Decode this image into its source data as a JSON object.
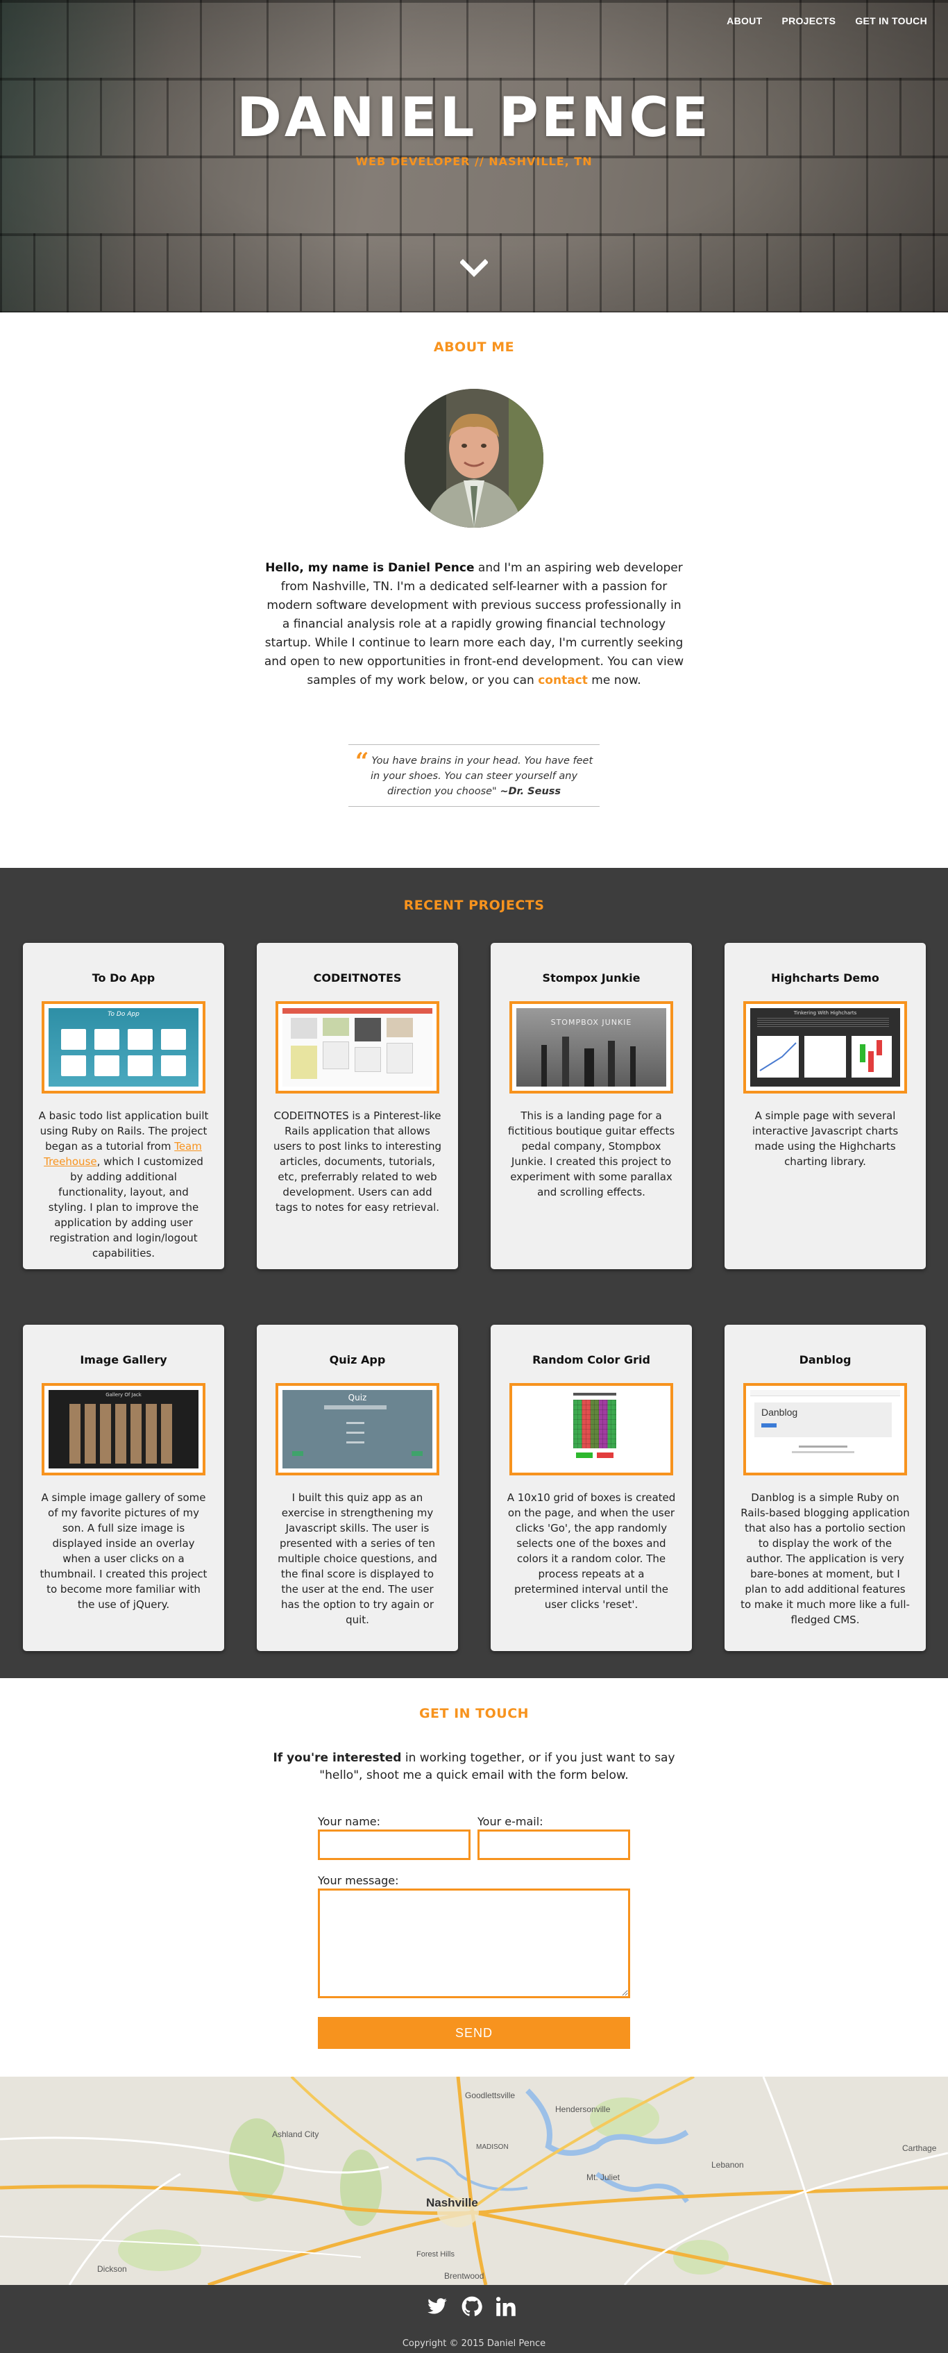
{
  "nav": {
    "items": [
      "ABOUT",
      "PROJECTS",
      "GET IN TOUCH"
    ]
  },
  "hero": {
    "title": "DANIEL PENCE",
    "subtitle": "WEB DEVELOPER // NASHVILLE, TN"
  },
  "about": {
    "heading": "ABOUT ME",
    "intro_bold": "Hello, my name is Daniel Pence",
    "intro_rest": " and I'm an aspiring web developer from Nashville, TN. I'm a dedicated self-learner with a passion for modern software development with previous success professionally in a financial analysis role at a rapidly growing financial technology startup. While I continue to learn more each day, I'm currently seeking and open to new opportunities in front-end development. You can view samples of my work below, or you can ",
    "contact_link": "contact",
    "outro": " me now.",
    "quote_text": "You have brains in your head. You have feet in your shoes. You can steer yourself any direction you choose\"",
    "quote_author": "~Dr. Seuss"
  },
  "projects": {
    "heading": "RECENT PROJECTS",
    "cards": [
      {
        "title": "To Do App",
        "desc_a": "A basic todo list application built using Ruby on Rails. The project began as a tutorial from ",
        "link": "Team Treehouse",
        "desc_b": ", which I customized by adding additional functionality, layout, and styling. I plan to improve the application by adding user registration and login/logout capabilities."
      },
      {
        "title": "CODEITNOTES",
        "desc_a": "CODEITNOTES is a Pinterest-like Rails application that allows users to post links to interesting articles, documents, tutorials, etc, preferrably related to web development. Users can add tags to notes for easy retrieval.",
        "link": "",
        "desc_b": ""
      },
      {
        "title": "Stompox Junkie",
        "desc_a": "This is a landing page for a fictitious boutique guitar effects pedal company, Stompbox Junkie. I created this project to experiment with some parallax and scrolling effects.",
        "link": "",
        "desc_b": ""
      },
      {
        "title": "Highcharts Demo",
        "desc_a": "A simple page with several interactive Javascript charts made using the Highcharts charting library.",
        "link": "",
        "desc_b": ""
      },
      {
        "title": "Image Gallery",
        "desc_a": "A simple image gallery of some of my favorite pictures of my son. A full size image is displayed inside an overlay when a user clicks on a thumbnail. I created this project to become more familiar with the use of jQuery.",
        "link": "",
        "desc_b": ""
      },
      {
        "title": "Quiz App",
        "desc_a": "I built this quiz app as an exercise in strengthening my Javascript skills. The user is presented with a series of ten multiple choice questions, and the final score is displayed to the user at the end. The user has the option to try again or quit.",
        "link": "",
        "desc_b": ""
      },
      {
        "title": "Random Color Grid",
        "desc_a": "A 10x10 grid of boxes is created on the page, and when the user clicks 'Go', the app randomly selects one of the boxes and colors it a random color. The process repeats at a pretermined interval until the user clicks 'reset'.",
        "link": "",
        "desc_b": ""
      },
      {
        "title": "Danblog",
        "desc_a": "Danblog is a simple Ruby on Rails-based blogging application that also has a portolio section to display the work of the author. The application is very bare-bones at moment, but I plan to add additional features to make it much more like a full-fledged CMS.",
        "link": "",
        "desc_b": ""
      }
    ],
    "thumb_texts": {
      "todo": "To Do App",
      "stompbox": "STOMPBOX JUNKIE",
      "highcharts": "Tinkering With Highcharts",
      "gallery": "Gallery Of Jack",
      "quiz": "Quiz",
      "danblog": "Danblog"
    }
  },
  "contact": {
    "heading": "GET IN TOUCH",
    "text_bold": "If you're interested",
    "text_rest": " in working together, or if you just want to say \"hello\", shoot me a quick email with the form below.",
    "name_label": "Your name:",
    "email_label": "Your e-mail:",
    "message_label": "Your message:",
    "send_label": "SEND"
  },
  "map": {
    "labels": [
      "Goodlettsville",
      "Hendersonville",
      "Ashland City",
      "MADISON",
      "Nashville",
      "Mt. Juliet",
      "Lebanon",
      "Carthage",
      "Forest Hills",
      "Dickson",
      "Brentwood"
    ]
  },
  "footer": {
    "copyright": "Copyright © 2015 Daniel Pence"
  },
  "colors": {
    "accent": "#f7931e",
    "dark": "#3d3d3d"
  }
}
